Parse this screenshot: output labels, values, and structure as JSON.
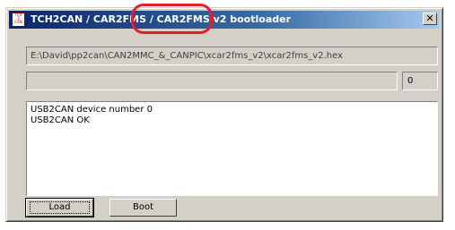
{
  "window": {
    "title": "TCH2CAN / CAR2FMS / CAR2FMS v2 bootloader",
    "close_glyph": "✕",
    "icon_text": [
      "TCH",
      "2",
      "CAN"
    ]
  },
  "file_path": "E:\\David\\pp2can\\CAN2MMC_&_CANPIC\\xcar2fms_v2\\xcar2fms_v2.hex",
  "progress": {
    "value_percent": 0,
    "count": "0"
  },
  "log": {
    "lines": [
      "USB2CAN device number 0",
      "USB2CAN OK"
    ]
  },
  "buttons": {
    "load": "Load",
    "boot": "Boot"
  },
  "annotation": {
    "color": "#e0202a"
  }
}
